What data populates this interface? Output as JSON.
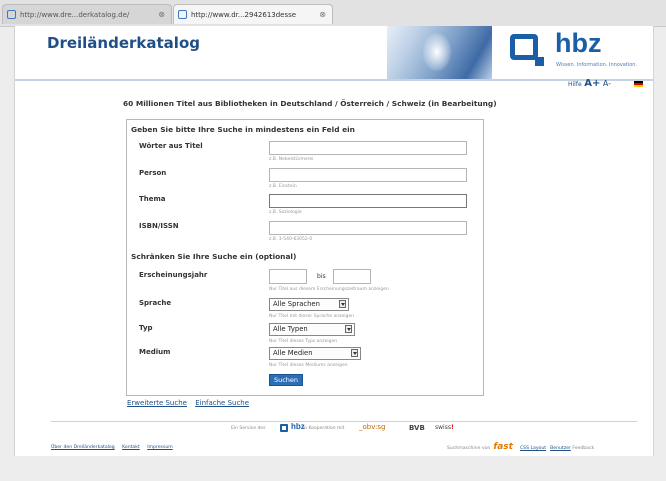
{
  "browser": {
    "tabs": [
      {
        "label": "http://www.dre...derkatalog.de/",
        "close": "⊗",
        "active": false
      },
      {
        "label": "http://www.dr...2942613desse",
        "close": "⊗",
        "active": true
      }
    ]
  },
  "header": {
    "title": "Dreiländerkatalog",
    "logo_text": "hbz",
    "logo_tagline": "Wissen. Information. Innovation."
  },
  "utility": {
    "help": "Hilfe",
    "font_plus": "A+",
    "font_minus": "A-"
  },
  "subtitle": "60 Millionen Titel aus Bibliotheken in Deutschland / Österreich / Schweiz (in Bearbeitung)",
  "form": {
    "section1_title": "Geben Sie bitte Ihre Suche in mindestens ein Feld ein",
    "fields": [
      {
        "label": "Wörter aus Titel",
        "value": "",
        "hint": "z.B. Nebelstürmerei"
      },
      {
        "label": "Person",
        "value": "",
        "hint": "z.B. Einstein"
      },
      {
        "label": "Thema",
        "value": "",
        "hint": "z.B. Soziologie"
      },
      {
        "label": "ISBN/ISSN",
        "value": "",
        "hint": "z.B. 3-540-63052-0"
      }
    ],
    "section2_title": "Schränken Sie Ihre Suche ein (optional)",
    "year": {
      "label": "Erscheinungsjahr",
      "between": "bis",
      "from": "",
      "to": "",
      "hint": "Nur Titel aus diesem Erscheinungszeitraum anzeigen"
    },
    "selects": [
      {
        "label": "Sprache",
        "value": "Alle Sprachen",
        "hint": "Nur Titel mit dieser Sprache anzeigen"
      },
      {
        "label": "Typ",
        "value": "Alle Typen",
        "hint": "Nur Titel dieses Typs anzeigen"
      },
      {
        "label": "Medium",
        "value": "Alle Medien",
        "hint": "Nur Titel dieses Mediums anzeigen"
      }
    ],
    "submit": "Suchen"
  },
  "links": {
    "advanced": "Erweiterte Suche",
    "simple": "Einfache Suche"
  },
  "footer": {
    "service_text": "Ein Service des",
    "hbz": "hbz",
    "coop_text": "in Kooperation mit",
    "obv": "_obv:sg",
    "bvb": "BVB",
    "swiss": "swiss",
    "swiss_mark": "!",
    "left_links": [
      "Über den Dreiländerkatalog",
      "Kontakt",
      "Impressum"
    ],
    "engine_text": "Suchmaschine von",
    "fast": "fast",
    "lnk1": "CSS Layout",
    "lnk2": "Benutzer",
    "tail": "Feedback"
  }
}
